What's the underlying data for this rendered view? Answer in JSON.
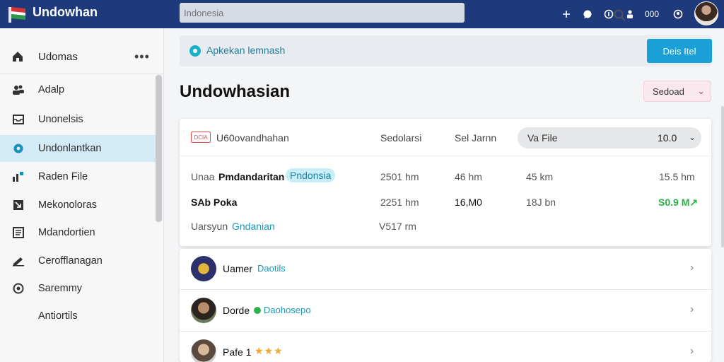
{
  "app": {
    "title": "Undowhan",
    "logo_icon": "flag-logo-icon",
    "brand_color": "#1f3a7a",
    "accent_color": "#1aa0d6"
  },
  "search": {
    "placeholder": "Indonesia",
    "value": ""
  },
  "topbar": {
    "icons": [
      "plus-icon",
      "chat-icon",
      "info-icon",
      "user-icon"
    ],
    "count": "000"
  },
  "sidebar": {
    "header": "Udomas",
    "items": [
      {
        "label": "Adalp",
        "icon": "people-icon",
        "active": false
      },
      {
        "label": "Unonelsis",
        "icon": "inbox-icon",
        "active": false
      },
      {
        "label": "Undonlantkan",
        "icon": "settings-icon",
        "active": true
      },
      {
        "label": "Raden File",
        "icon": "chart-icon",
        "active": false
      },
      {
        "label": "Mekonoloras",
        "icon": "arrow-icon",
        "active": false
      },
      {
        "label": "Mdandortien",
        "icon": "list-icon",
        "active": false
      },
      {
        "label": "Cerofflanagan",
        "icon": "edit-icon",
        "active": false
      },
      {
        "label": "Saremmy",
        "icon": "shield-icon",
        "active": false
      },
      {
        "label": "Antiortils",
        "icon": "",
        "active": false
      }
    ]
  },
  "notice": {
    "text": "Apkekan lemnash"
  },
  "primary_button": "Deis Itel",
  "page": {
    "title": "Undowhasian",
    "sort_label": "Sedoad"
  },
  "table": {
    "tag": "DCIA",
    "header": {
      "name": "U60ovandhahan",
      "col2": "Sedolarsi",
      "col3": "Sel Jarnn",
      "file_label": "Va File",
      "file_value": "10.0"
    },
    "rows": [
      {
        "prefix": "Unaa",
        "name": "Pmdandaritan",
        "chip": "Pndonsia",
        "c2": "2501 hm",
        "c3": "46 hm",
        "c4": "45 km",
        "c5": "15.5 hm"
      },
      {
        "prefix": "",
        "name": "SAb Poka",
        "chip": "",
        "c2": "2251 hm",
        "c3": "16,M0",
        "c4": "18J bn",
        "c5": "S0.9 M↗"
      },
      {
        "prefix": "Uarsyun",
        "name": "",
        "chip": "Gndanian",
        "c2": "V517 rm",
        "c3": "",
        "c4": "",
        "c5": ""
      }
    ]
  },
  "list": {
    "items": [
      {
        "name": "Uamer",
        "tag": "Daotils"
      },
      {
        "name": "Dorde",
        "tag": "Daohosepo"
      },
      {
        "name": "Pafe 1",
        "stars": "★★★"
      }
    ]
  }
}
